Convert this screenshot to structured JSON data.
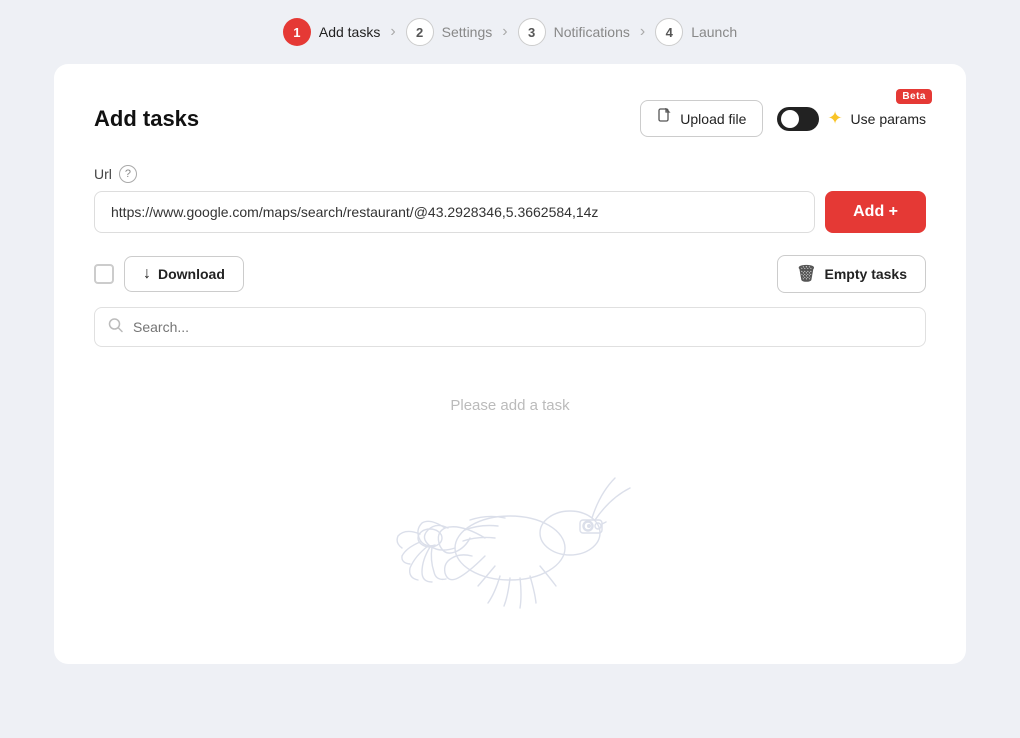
{
  "stepper": {
    "steps": [
      {
        "num": "1",
        "label": "Add tasks",
        "active": true
      },
      {
        "num": "2",
        "label": "Settings",
        "active": false
      },
      {
        "num": "3",
        "label": "Notifications",
        "active": false
      },
      {
        "num": "4",
        "label": "Launch",
        "active": false
      }
    ]
  },
  "card": {
    "title": "Add tasks",
    "upload_label": "Upload file",
    "use_params_label": "Use params",
    "beta_label": "Beta",
    "url_label": "Url",
    "url_placeholder": "https://www.google.com/maps/search/restaurant/@43.2928346,5.3662584,14z",
    "url_value": "https://www.google.com/maps/search/restaurant/@43.2928346,5.3662584,14z",
    "add_label": "Add +",
    "download_label": "Download",
    "empty_tasks_label": "Empty tasks",
    "search_placeholder": "Search...",
    "empty_state_text": "Please add a task"
  },
  "icons": {
    "upload": "📄",
    "download_arrow": "↓",
    "trash": "🗑",
    "search": "🔍",
    "star": "✦",
    "help": "?"
  }
}
